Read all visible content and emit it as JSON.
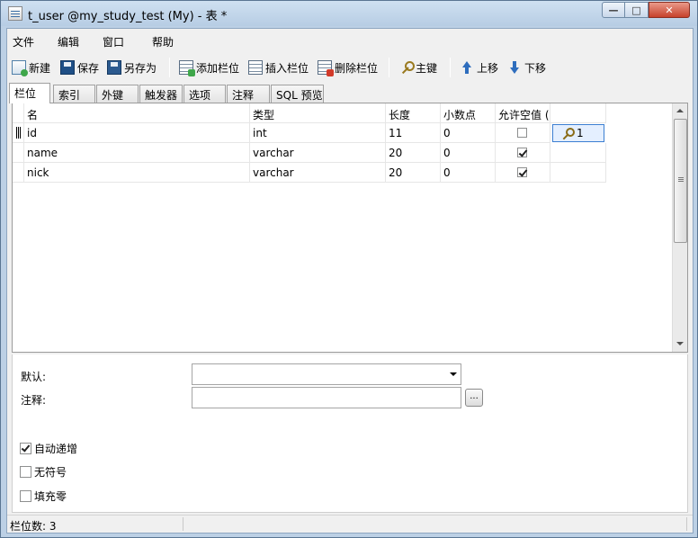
{
  "window": {
    "title": "t_user @my_study_test (My) - 表 *",
    "controls": {
      "minimize": "—",
      "maximize": "□",
      "close": "✕"
    }
  },
  "menu": [
    "文件",
    "编辑",
    "窗口",
    "帮助"
  ],
  "toolbar": {
    "new": "新建",
    "save": "保存",
    "save_as": "另存为",
    "add_column": "添加栏位",
    "insert_column": "插入栏位",
    "delete_column": "删除栏位",
    "primary_key": "主键",
    "move_up": "上移",
    "move_down": "下移"
  },
  "tabs": [
    "栏位",
    "索引",
    "外键",
    "触发器",
    "选项",
    "注释",
    "SQL 预览"
  ],
  "grid": {
    "headers": [
      "名",
      "类型",
      "长度",
      "小数点",
      "允许空值 (",
      ""
    ],
    "rows": [
      {
        "name": "id",
        "type": "int",
        "length": "11",
        "decimals": "0",
        "nullable": false,
        "key": "1"
      },
      {
        "name": "name",
        "type": "varchar",
        "length": "20",
        "decimals": "0",
        "nullable": true,
        "key": ""
      },
      {
        "name": "nick",
        "type": "varchar",
        "length": "20",
        "decimals": "0",
        "nullable": true,
        "key": ""
      }
    ]
  },
  "properties": {
    "default_label": "默认:",
    "comment_label": "注释:",
    "browse_button": "...",
    "auto_increment_label": "自动递增",
    "auto_increment": true,
    "unsigned_label": "无符号",
    "unsigned": false,
    "zerofill_label": "填充零",
    "zerofill": false
  },
  "status": {
    "text": "栏位数: 3"
  }
}
